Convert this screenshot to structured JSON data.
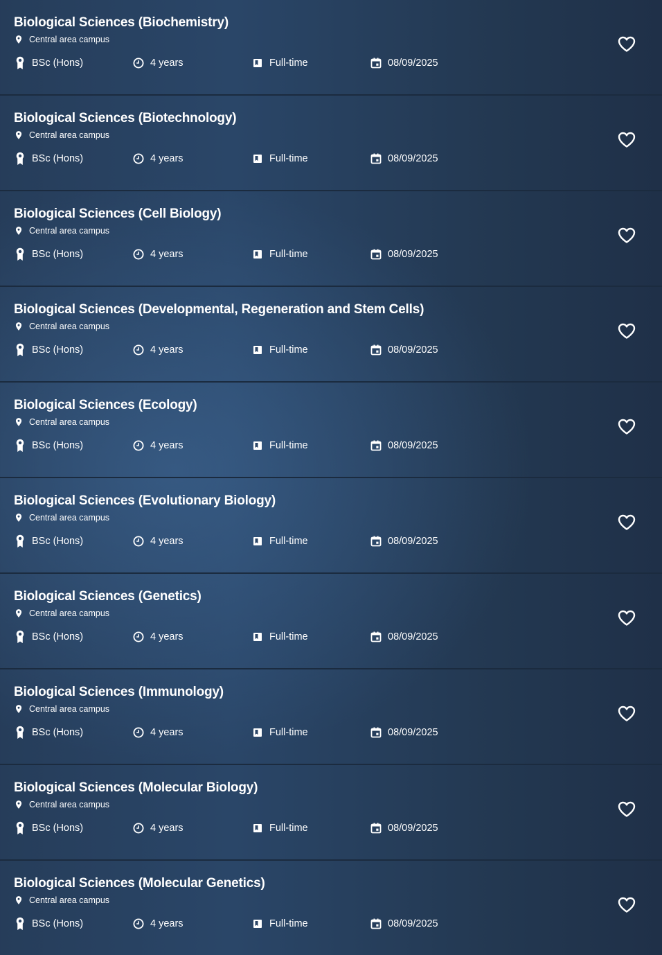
{
  "courses": [
    {
      "title": "Biological Sciences (Biochemistry)",
      "campus": "Central area campus",
      "award": "BSc (Hons)",
      "duration": "4 years",
      "mode": "Full-time",
      "start_date": "08/09/2025"
    },
    {
      "title": "Biological Sciences (Biotechnology)",
      "campus": "Central area campus",
      "award": "BSc (Hons)",
      "duration": "4 years",
      "mode": "Full-time",
      "start_date": "08/09/2025"
    },
    {
      "title": "Biological Sciences (Cell Biology)",
      "campus": "Central area campus",
      "award": "BSc (Hons)",
      "duration": "4 years",
      "mode": "Full-time",
      "start_date": "08/09/2025"
    },
    {
      "title": "Biological Sciences (Developmental, Regeneration and Stem Cells)",
      "campus": "Central area campus",
      "award": "BSc (Hons)",
      "duration": "4 years",
      "mode": "Full-time",
      "start_date": "08/09/2025"
    },
    {
      "title": "Biological Sciences (Ecology)",
      "campus": "Central area campus",
      "award": "BSc (Hons)",
      "duration": "4 years",
      "mode": "Full-time",
      "start_date": "08/09/2025"
    },
    {
      "title": "Biological Sciences (Evolutionary Biology)",
      "campus": "Central area campus",
      "award": "BSc (Hons)",
      "duration": "4 years",
      "mode": "Full-time",
      "start_date": "08/09/2025"
    },
    {
      "title": "Biological Sciences (Genetics)",
      "campus": "Central area campus",
      "award": "BSc (Hons)",
      "duration": "4 years",
      "mode": "Full-time",
      "start_date": "08/09/2025"
    },
    {
      "title": "Biological Sciences (Immunology)",
      "campus": "Central area campus",
      "award": "BSc (Hons)",
      "duration": "4 years",
      "mode": "Full-time",
      "start_date": "08/09/2025"
    },
    {
      "title": "Biological Sciences (Molecular Biology)",
      "campus": "Central area campus",
      "award": "BSc (Hons)",
      "duration": "4 years",
      "mode": "Full-time",
      "start_date": "08/09/2025"
    },
    {
      "title": "Biological Sciences (Molecular Genetics)",
      "campus": "Central area campus",
      "award": "BSc (Hons)",
      "duration": "4 years",
      "mode": "Full-time",
      "start_date": "08/09/2025"
    }
  ],
  "icons": {
    "campus": "map-pin-icon",
    "award": "award-ribbon-icon",
    "duration": "clock-icon",
    "mode": "book-icon",
    "start_date": "calendar-icon",
    "favourite": "heart-outline-icon"
  },
  "colors": {
    "background": "#243b55",
    "divider": "#1b2b3f",
    "text": "#ffffff"
  }
}
